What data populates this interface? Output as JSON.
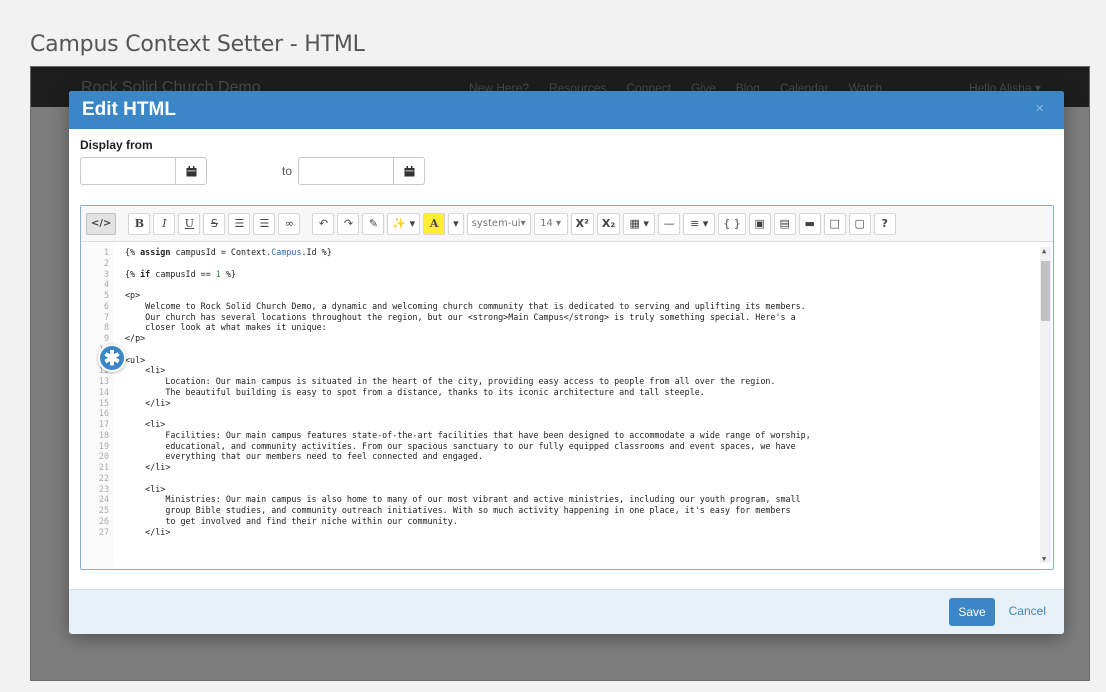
{
  "page_title": "Campus Context Setter - HTML",
  "site_nav": {
    "brand": "Rock Solid Church Demo",
    "links": [
      "New Here?",
      "Resources",
      "Connect",
      "Give",
      "Blog",
      "Calendar",
      "Watch"
    ],
    "user": "Hello Alisha ▾"
  },
  "modal": {
    "title": "Edit HTML",
    "close": "×",
    "display_from_label": "Display from",
    "to_label": "to",
    "start_date": {
      "value": "",
      "placeholder": ""
    },
    "end_date": {
      "value": "",
      "placeholder": ""
    },
    "save_label": "Save",
    "cancel_label": "Cancel"
  },
  "toolbar": {
    "code_view": "</>",
    "bold": "B",
    "italic": "I",
    "underline": "U",
    "strikethrough": "S",
    "ordered_list": "☰",
    "unordered_list": "☰",
    "link": "∞",
    "undo": "↶",
    "redo": "↷",
    "clear_format": "✎",
    "style": "✨ ▾",
    "highlight": "A",
    "color_dropdown": "▾",
    "font_family": "system-ui",
    "font_size": "14",
    "superscript": "X²",
    "subscript": "X₂",
    "table": "▦ ▾",
    "hr": "—",
    "align": "≡ ▾",
    "lava": "{ }",
    "image": "▣",
    "file": "▤",
    "folder": "▬",
    "paste": "□",
    "paste_text": "▢",
    "help": "?"
  },
  "code_lines": [
    {
      "n": "1",
      "parts": [
        {
          "t": "{% "
        },
        {
          "t": "assign",
          "c": "kw"
        },
        {
          "t": " campusId = Context."
        },
        {
          "t": "Campus",
          "c": "blue"
        },
        {
          "t": ".Id %}"
        }
      ]
    },
    {
      "n": "2",
      "parts": []
    },
    {
      "n": "3",
      "parts": [
        {
          "t": "{% "
        },
        {
          "t": "if",
          "c": "kw"
        },
        {
          "t": " campusId == "
        },
        {
          "t": "1",
          "c": "num"
        },
        {
          "t": " %}"
        }
      ]
    },
    {
      "n": "4",
      "parts": []
    },
    {
      "n": "5",
      "parts": [
        {
          "t": "<p>"
        }
      ]
    },
    {
      "n": "6",
      "parts": [
        {
          "t": "    Welcome to Rock Solid Church Demo, a dynamic and welcoming church community that is dedicated to serving and uplifting its members."
        }
      ]
    },
    {
      "n": "7",
      "parts": [
        {
          "t": "    Our church has several locations throughout the region, but our <strong>Main Campus</strong> is truly something special. Here's a"
        }
      ]
    },
    {
      "n": "8",
      "parts": [
        {
          "t": "    closer look at what makes it unique:"
        }
      ]
    },
    {
      "n": "9",
      "parts": [
        {
          "t": "</p>"
        }
      ]
    },
    {
      "n": "10",
      "parts": []
    },
    {
      "n": "11",
      "parts": [
        {
          "t": "<ul>"
        }
      ]
    },
    {
      "n": "12",
      "parts": [
        {
          "t": "    <li>"
        }
      ]
    },
    {
      "n": "13",
      "parts": [
        {
          "t": "        Location: Our main campus is situated in the heart of the city, providing easy access to people from all over the region."
        }
      ]
    },
    {
      "n": "14",
      "parts": [
        {
          "t": "        The beautiful building is easy to spot from a distance, thanks to its iconic architecture and tall steeple."
        }
      ]
    },
    {
      "n": "15",
      "parts": [
        {
          "t": "    </li>"
        }
      ]
    },
    {
      "n": "16",
      "parts": []
    },
    {
      "n": "17",
      "parts": [
        {
          "t": "    <li>"
        }
      ]
    },
    {
      "n": "18",
      "parts": [
        {
          "t": "        Facilities: Our main campus features state-of-the-art facilities that have been designed to accommodate a wide range of worship,"
        }
      ]
    },
    {
      "n": "19",
      "parts": [
        {
          "t": "        educational, and community activities. From our spacious sanctuary to our fully equipped classrooms and event spaces, we have"
        }
      ]
    },
    {
      "n": "20",
      "parts": [
        {
          "t": "        everything that our members need to feel connected and engaged."
        }
      ]
    },
    {
      "n": "21",
      "parts": [
        {
          "t": "    </li>"
        }
      ]
    },
    {
      "n": "22",
      "parts": []
    },
    {
      "n": "23",
      "parts": [
        {
          "t": "    <li>"
        }
      ]
    },
    {
      "n": "24",
      "parts": [
        {
          "t": "        Ministries: Our main campus is also home to many of our most vibrant and active ministries, including our youth program, small"
        }
      ]
    },
    {
      "n": "25",
      "parts": [
        {
          "t": "        group Bible studies, and community outreach initiatives. With so much activity happening in one place, it's easy for members"
        }
      ]
    },
    {
      "n": "26",
      "parts": [
        {
          "t": "        to get involved and find their niche within our community."
        }
      ]
    },
    {
      "n": "27",
      "parts": [
        {
          "t": "    </li>"
        }
      ]
    }
  ],
  "badge": "✱",
  "colors": {
    "primary": "#3a86c6",
    "footer_bg": "#e8f0f8",
    "overlay": "#7d7d7d"
  }
}
